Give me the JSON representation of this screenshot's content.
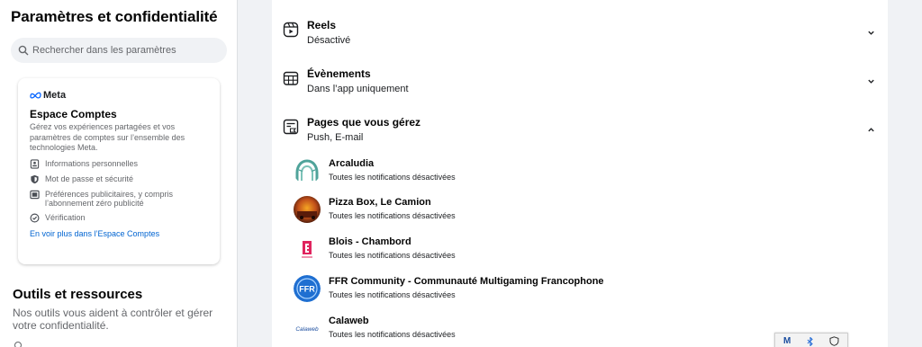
{
  "sidebar": {
    "title": "Paramètres et confidentialité",
    "search_placeholder": "Rechercher dans les paramètres",
    "accounts_center": {
      "brand": "Meta",
      "title": "Espace Comptes",
      "description": "Gérez vos expériences partagées et vos paramètres de comptes sur l’ensemble des technologies Meta.",
      "items": [
        {
          "label": "Informations personnelles",
          "icon": "id-card-icon"
        },
        {
          "label": "Mot de passe et sécurité",
          "icon": "shield-icon"
        },
        {
          "label": "Préférences publicitaires, y compris l’abonnement zéro publicité",
          "icon": "monitor-icon"
        },
        {
          "label": "Vérification",
          "icon": "check-circle-icon"
        }
      ],
      "link": "En voir plus dans l’Espace Comptes"
    },
    "tools": {
      "title": "Outils et ressources",
      "description": "Nos outils vous aident à contrôler et gérer votre confidentialité."
    }
  },
  "settings": [
    {
      "title": "Reels",
      "subtitle": "Désactivé",
      "icon": "reels-icon",
      "expanded": false
    },
    {
      "title": "Évènements",
      "subtitle": "Dans l’app uniquement",
      "icon": "calendar-icon",
      "expanded": false
    },
    {
      "title": "Pages que vous gérez",
      "subtitle": "Push, E-mail",
      "icon": "pages-icon",
      "expanded": true
    }
  ],
  "pages": [
    {
      "name": "Arcaludia",
      "status": "Toutes les notifications désactivées"
    },
    {
      "name": "Pizza Box, Le Camion",
      "status": "Toutes les notifications désactivées"
    },
    {
      "name": "Blois - Chambord",
      "status": "Toutes les notifications désactivées"
    },
    {
      "name": "FFR Community - Communauté Multigaming Francophone",
      "status": "Toutes les notifications désactivées",
      "logo_text": "FFR"
    },
    {
      "name": "Calaweb",
      "status": "Toutes les notifications désactivées",
      "logo_text": "Calaweb"
    }
  ],
  "colors": {
    "accent": "#0064d1",
    "background": "#f0f2f5",
    "secondary_text": "#65676b"
  }
}
